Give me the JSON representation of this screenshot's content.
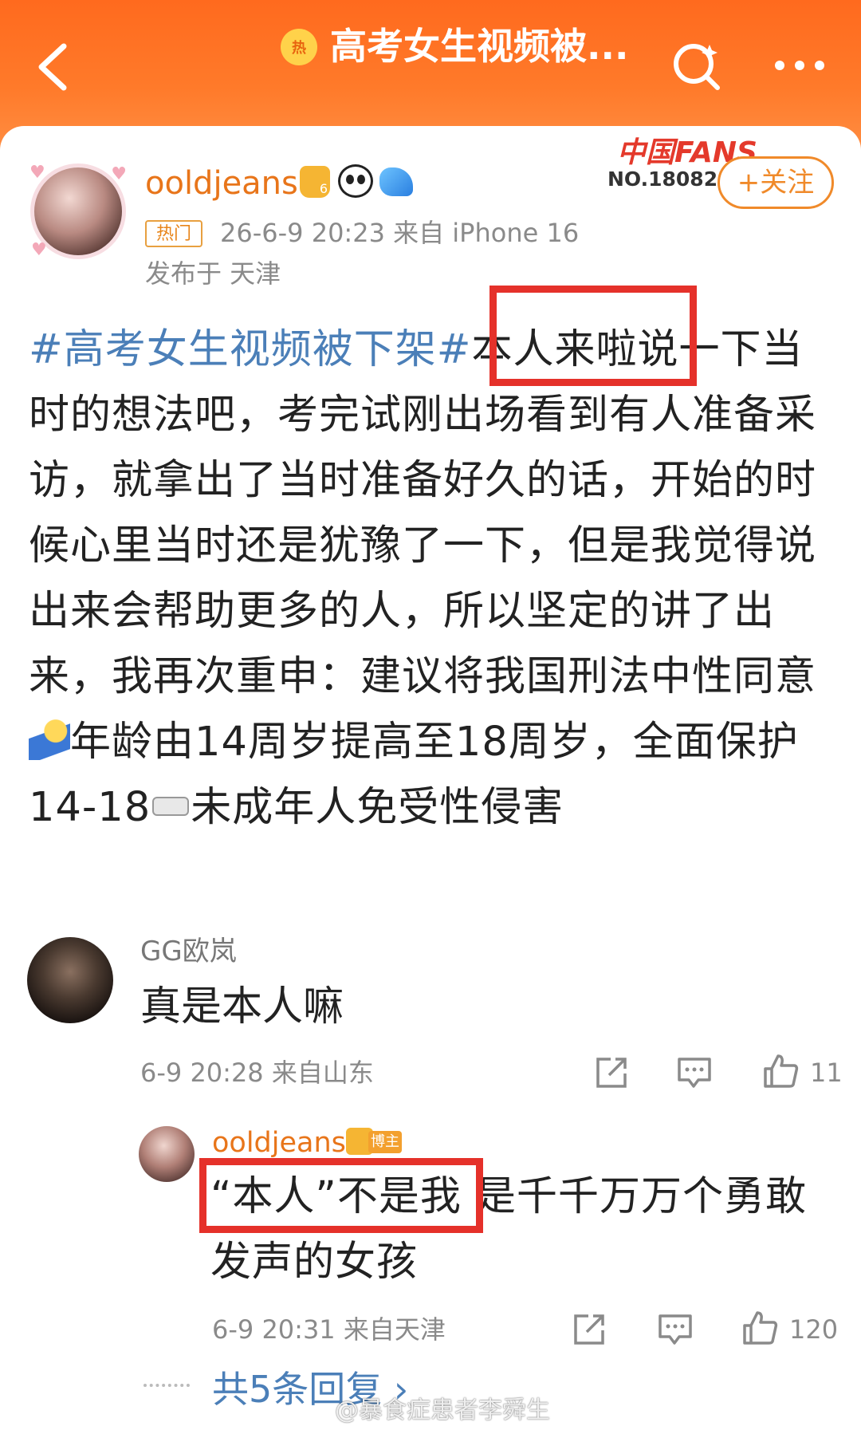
{
  "header": {
    "hot_badge": "热",
    "title": "高考女生视频被..."
  },
  "post": {
    "username": "ooldjeans",
    "crown_level": "6",
    "tag": "热门",
    "meta": "26-6-9 20:23   来自 iPhone 16",
    "location": "发布于 天津",
    "fans_logo_text": "中国FANS",
    "fans_no": "NO.180825",
    "follow_label": "+关注",
    "hashtag": "#高考女生视频被下架#",
    "highlight": "本人来啦",
    "body_part1": "说一下当时的想法吧，考完试刚出场看到有人准备采访，就拿出了当时准备好久的话，开始的时候心里当时还是犹豫了一下，但是我觉得说出来会帮助更多的人，所以坚定的讲了出来，我再次重申：建议将我国刑法中性同意",
    "body_part2": "年龄由14周岁提高至18周岁，全面保护14-18",
    "body_part3": "未成年人免受性侵害"
  },
  "comment": {
    "username": "GG欧岚",
    "text": "真是本人嘛",
    "meta": "6-9 20:28  来自山东",
    "like_count": "11"
  },
  "reply": {
    "username": "ooldjeans",
    "host_badge": "博主",
    "highlight": "“本人”不是我",
    "text_rest": "  是千千万万个勇敢发声的女孩",
    "meta": "6-9 20:31  来自天津",
    "like_count": "120",
    "more_replies": "共5条回复 ›"
  },
  "watermark": "@暴食症患者李舜生",
  "colors": {
    "header": "#ff7a2a",
    "username": "#e8751a",
    "hashtag": "#4b7fb8",
    "highlight_box": "#e5312a"
  }
}
